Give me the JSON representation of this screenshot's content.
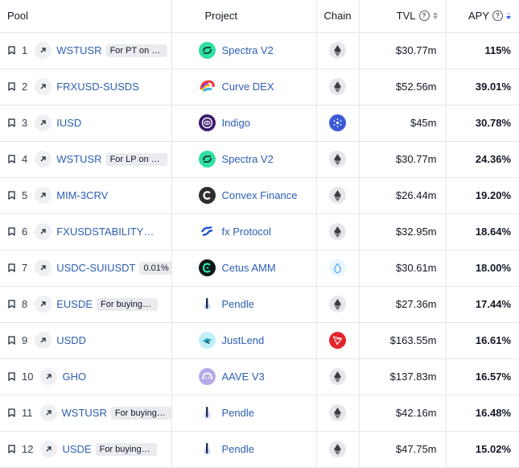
{
  "header": {
    "pool": "Pool",
    "project": "Project",
    "chain": "Chain",
    "tvl": "TVL",
    "apy": "APY"
  },
  "rows": [
    {
      "rank": "1",
      "pool": "WSTUSR",
      "tag": "For PT on wstUSR",
      "project": "Spectra V2",
      "logo": "spectra",
      "chain": "ethereum",
      "tvl": "$30.77m",
      "apy": "115%"
    },
    {
      "rank": "2",
      "pool": "FRXUSD-SUSDS",
      "tag": "",
      "project": "Curve DEX",
      "logo": "curve",
      "chain": "ethereum",
      "tvl": "$52.56m",
      "apy": "39.01%"
    },
    {
      "rank": "3",
      "pool": "IUSD",
      "tag": "",
      "project": "Indigo",
      "logo": "indigo",
      "chain": "cardano",
      "tvl": "$45m",
      "apy": "30.78%"
    },
    {
      "rank": "4",
      "pool": "WSTUSR",
      "tag": "For LP on wstUSR",
      "project": "Spectra V2",
      "logo": "spectra",
      "chain": "ethereum",
      "tvl": "$30.77m",
      "apy": "24.36%"
    },
    {
      "rank": "5",
      "pool": "MIM-3CRV",
      "tag": "",
      "project": "Convex Finance",
      "logo": "convex",
      "chain": "ethereum",
      "tvl": "$26.44m",
      "apy": "19.20%"
    },
    {
      "rank": "6",
      "pool": "FXUSDSTABILITYPOOL",
      "tag": "",
      "project": "fx Protocol",
      "logo": "fx",
      "chain": "ethereum",
      "tvl": "$32.95m",
      "apy": "18.64%"
    },
    {
      "rank": "7",
      "pool": "USDC-SUIUSDT",
      "tag": "0.01%",
      "project": "Cetus AMM",
      "logo": "cetus",
      "chain": "sui",
      "tvl": "$30.61m",
      "apy": "18.00%"
    },
    {
      "rank": "8",
      "pool": "EUSDE",
      "tag": "For buying PT-eUSDe",
      "project": "Pendle",
      "logo": "pendle",
      "chain": "ethereum",
      "tvl": "$27.36m",
      "apy": "17.44%"
    },
    {
      "rank": "9",
      "pool": "USDD",
      "tag": "",
      "project": "JustLend",
      "logo": "justlend",
      "chain": "tron",
      "tvl": "$163.55m",
      "apy": "16.61%"
    },
    {
      "rank": "10",
      "pool": "GHO",
      "tag": "",
      "project": "AAVE V3",
      "logo": "aave",
      "chain": "ethereum",
      "tvl": "$137.83m",
      "apy": "16.57%"
    },
    {
      "rank": "11",
      "pool": "WSTUSR",
      "tag": "For buying PT-wstUSR",
      "project": "Pendle",
      "logo": "pendle",
      "chain": "ethereum",
      "tvl": "$42.16m",
      "apy": "16.48%"
    },
    {
      "rank": "12",
      "pool": "USDE",
      "tag": "For buying PT-USDe",
      "project": "Pendle",
      "logo": "pendle",
      "chain": "ethereum",
      "tvl": "$47.75m",
      "apy": "15.02%"
    }
  ],
  "colors": {
    "link": "#2c5fb3",
    "sort_active": "#2563eb",
    "tron": "#e5232a",
    "cardano": "#3b5bd9",
    "spectra": "#2fe0a2"
  },
  "icons": {
    "bookmark": "bookmark-icon",
    "external": "arrow-up-right-icon",
    "help": "question-circle-icon",
    "sort": "sort-icon"
  }
}
